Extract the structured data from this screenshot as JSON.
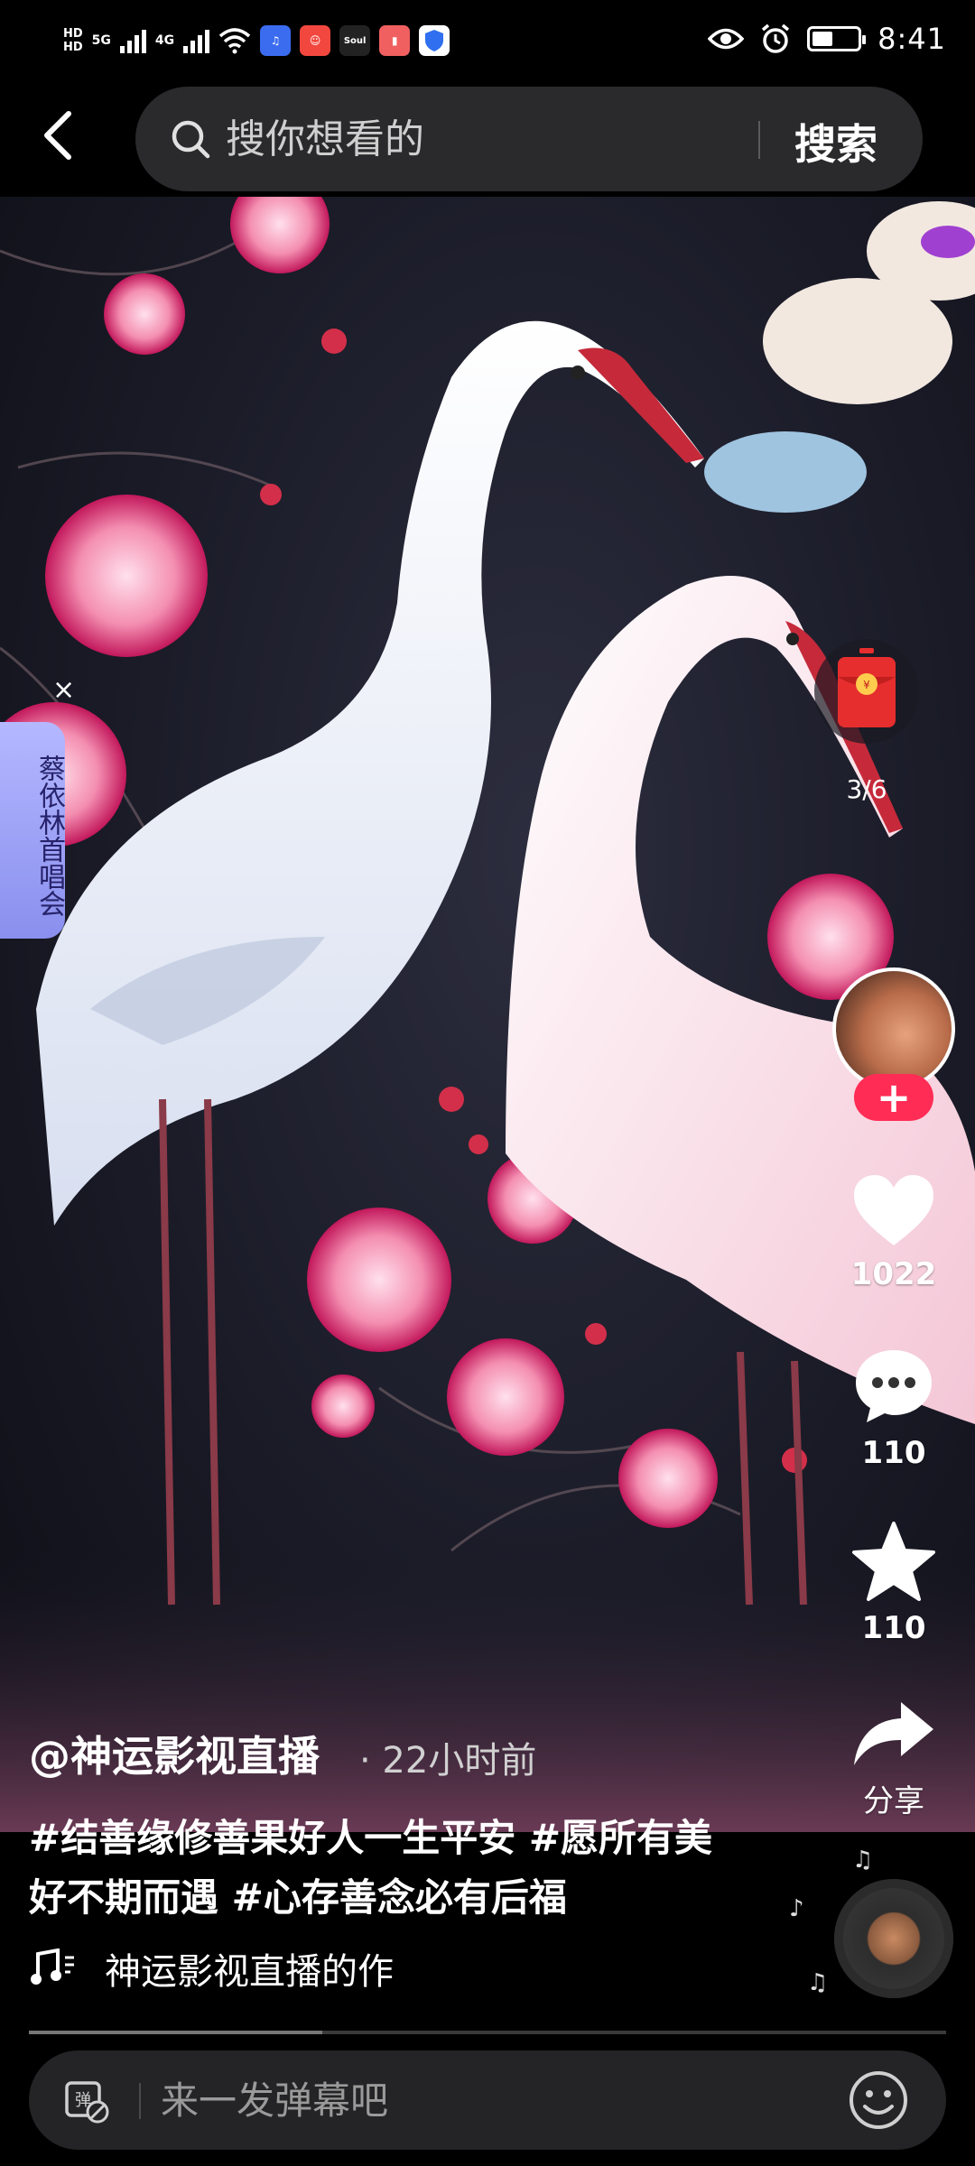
{
  "status_bar": {
    "network": [
      "HD",
      "5G",
      "4G"
    ],
    "time": "8:41",
    "battery_level": 0.45,
    "app_icons": [
      "music-app-icon",
      "social-app-icon",
      "soul-app-icon",
      "book-app-icon",
      "shield-app-icon"
    ],
    "soul_label": "Soul"
  },
  "search": {
    "placeholder": "搜你想看的",
    "button_label": "搜索"
  },
  "side_tag": {
    "label": "蔡依林首唱会",
    "close": "×"
  },
  "red_packet": {
    "count": "3/6"
  },
  "actions": {
    "follow_label": "+",
    "like_count": "1022",
    "comment_count": "110",
    "favorite_count": "110",
    "share_label": "分享"
  },
  "post": {
    "author": "@神运影视直播",
    "time": "· 22小时前",
    "caption": "#结善缘修善果好人一生平安 #愿所有美好不期而遇 #心存善念必有后福",
    "music": "神运影视直播的作"
  },
  "progress": {
    "value": 0.32
  },
  "danmaku": {
    "placeholder": "来一发弹幕吧"
  },
  "colors": {
    "accent": "#ff2c55",
    "search_bg": "#2a2a2c",
    "tag_bg": "#9aa0ff"
  }
}
